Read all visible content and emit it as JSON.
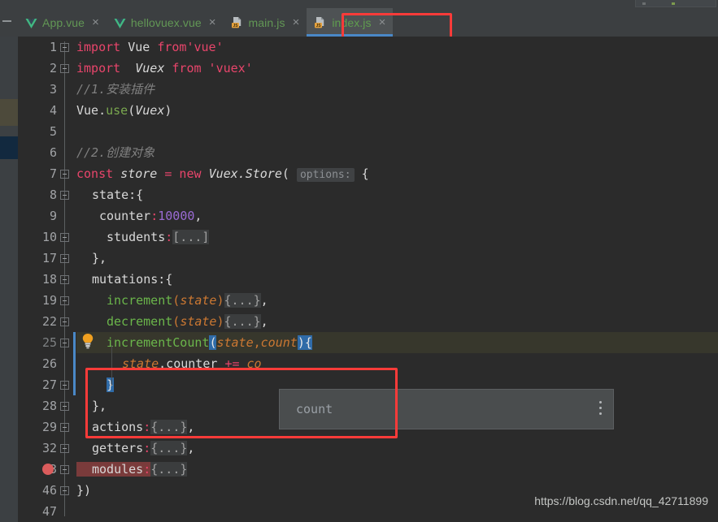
{
  "window": {
    "theme_bg": "#2b2b2b",
    "chrome_bg": "#3c3f41",
    "accent": "#4a88c7",
    "annotation_color": "#fb3b39"
  },
  "tabbar": {
    "tabs": [
      {
        "label": "App.vue",
        "icon": "vue-file-icon",
        "active": false,
        "close_glyph": "×"
      },
      {
        "label": "hellovuex.vue",
        "icon": "vue-file-icon",
        "active": false,
        "close_glyph": "×"
      },
      {
        "label": "main.js",
        "icon": "js-file-icon",
        "active": false,
        "close_glyph": "×"
      },
      {
        "label": "index.js",
        "icon": "js-file-icon",
        "active": true,
        "close_glyph": "×"
      }
    ]
  },
  "editor": {
    "lines": [
      {
        "num": "1",
        "text": "import Vue from'vue'"
      },
      {
        "num": "2",
        "text": "import  Vuex from 'vuex'"
      },
      {
        "num": "3",
        "text": "//1.安装插件"
      },
      {
        "num": "4",
        "text": "Vue.use(Vuex)"
      },
      {
        "num": "5",
        "text": ""
      },
      {
        "num": "6",
        "text": "//2.创建对象"
      },
      {
        "num": "7",
        "text": "const store = new Vuex.Store( options: {"
      },
      {
        "num": "8",
        "text": "state:{"
      },
      {
        "num": "9",
        "text": "counter:10000,"
      },
      {
        "num": "10",
        "text": "students:[...]"
      },
      {
        "num": "17",
        "text": "},"
      },
      {
        "num": "18",
        "text": "mutations:{"
      },
      {
        "num": "19",
        "text": "increment(state){...},"
      },
      {
        "num": "22",
        "text": "decrement(state){...},"
      },
      {
        "num": "25",
        "text": "incrementCount(state,count){"
      },
      {
        "num": "26",
        "text": "state.counter += co"
      },
      {
        "num": "27",
        "text": "}"
      },
      {
        "num": "28",
        "text": "},"
      },
      {
        "num": "29",
        "text": "actions:{...},"
      },
      {
        "num": "32",
        "text": "getters:{...},"
      },
      {
        "num": "43",
        "text": "modules:{...}"
      },
      {
        "num": "46",
        "text": "})"
      },
      {
        "num": "47",
        "text": ""
      }
    ],
    "tokens": {
      "kw_import": "import",
      "kw_const": "const",
      "kw_new": "new",
      "name_vue": "Vue",
      "name_vuex": "Vuex",
      "str_vue": "'vue'",
      "str_vuex": "'vuex'",
      "comment_1": "//1.安装插件",
      "comment_2": "//2.创建对象",
      "use_call": "Vue.use(Vuex)",
      "store_expr": "store",
      "store_ctor": "Vuex.Store(",
      "param_hint": "options:",
      "state_key": "state",
      "counter_key": "counter",
      "counter_value": "10000",
      "students_key": "students",
      "students_folded": "[...]",
      "mutations_key": "mutations",
      "increment_fn": "increment",
      "decrement_fn": "decrement",
      "increment_count_fn": "incrementCount",
      "arg_state": "state",
      "arg_count": "count",
      "body_folded": "{...}",
      "line26_expr": "state.counter += co",
      "actions_key": "actions",
      "getters_key": "getters",
      "modules_key": "modules",
      "close_paren": "})"
    },
    "breakpoint_line": "43",
    "highlighted_line": "25"
  },
  "completion_popup": {
    "item": "count",
    "menu_icon": "kebab-menu-icon"
  },
  "watermark": {
    "text": "https://blog.csdn.net/qq_42711899"
  }
}
